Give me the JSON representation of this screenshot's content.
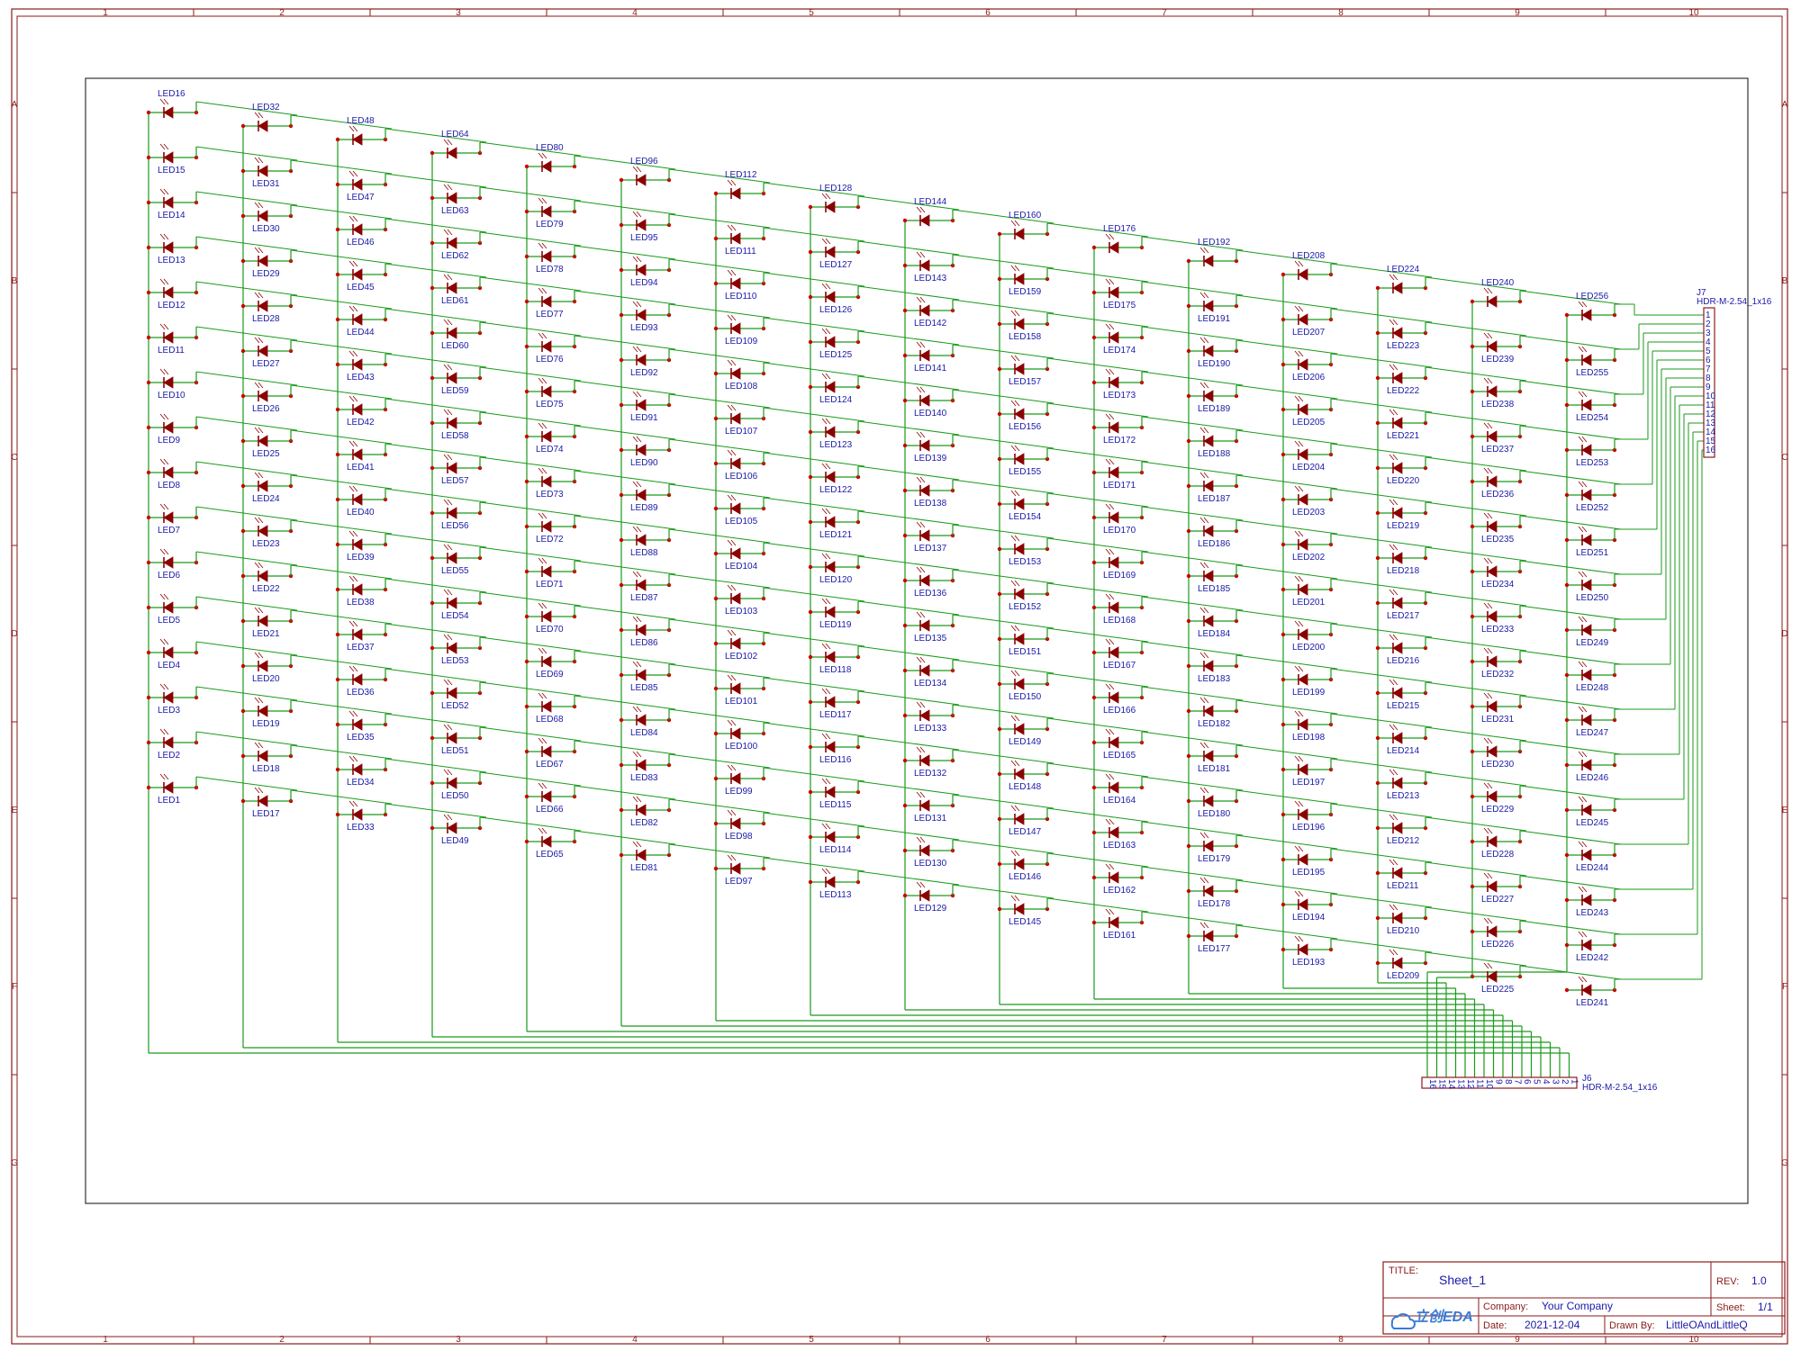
{
  "sheet": {
    "zones_x": [
      "1",
      "2",
      "3",
      "4",
      "5",
      "6",
      "7",
      "8",
      "9",
      "10"
    ],
    "zones_y": [
      "A",
      "B",
      "C",
      "D",
      "E",
      "F",
      "G"
    ]
  },
  "connectors": {
    "j7": {
      "ref": "J7",
      "footprint": "HDR-M-2.54_1x16",
      "pins": [
        "1",
        "2",
        "3",
        "4",
        "5",
        "6",
        "7",
        "8",
        "9",
        "10",
        "11",
        "12",
        "13",
        "14",
        "15",
        "16"
      ]
    },
    "j6": {
      "ref": "J6",
      "footprint": "HDR-M-2.54_1x16",
      "pins": [
        "16",
        "15",
        "14",
        "13",
        "12",
        "11",
        "10",
        "9",
        "8",
        "7",
        "6",
        "5",
        "4",
        "3",
        "2",
        "1"
      ]
    }
  },
  "led_columns": [
    [
      "LED16",
      "LED15",
      "LED14",
      "LED13",
      "LED12",
      "LED11",
      "LED10",
      "LED9",
      "LED8",
      "LED7",
      "LED6",
      "LED5",
      "LED4",
      "LED3",
      "LED2",
      "LED1"
    ],
    [
      "LED32",
      "LED31",
      "LED30",
      "LED29",
      "LED28",
      "LED27",
      "LED26",
      "LED25",
      "LED24",
      "LED23",
      "LED22",
      "LED21",
      "LED20",
      "LED19",
      "LED18",
      "LED17"
    ],
    [
      "LED48",
      "LED47",
      "LED46",
      "LED45",
      "LED44",
      "LED43",
      "LED42",
      "LED41",
      "LED40",
      "LED39",
      "LED38",
      "LED37",
      "LED36",
      "LED35",
      "LED34",
      "LED33"
    ],
    [
      "LED64",
      "LED63",
      "LED62",
      "LED61",
      "LED60",
      "LED59",
      "LED58",
      "LED57",
      "LED56",
      "LED55",
      "LED54",
      "LED53",
      "LED52",
      "LED51",
      "LED50",
      "LED49"
    ],
    [
      "LED80",
      "LED79",
      "LED78",
      "LED77",
      "LED76",
      "LED75",
      "LED74",
      "LED73",
      "LED72",
      "LED71",
      "LED70",
      "LED69",
      "LED68",
      "LED67",
      "LED66",
      "LED65"
    ],
    [
      "LED96",
      "LED95",
      "LED94",
      "LED93",
      "LED92",
      "LED91",
      "LED90",
      "LED89",
      "LED88",
      "LED87",
      "LED86",
      "LED85",
      "LED84",
      "LED83",
      "LED82",
      "LED81"
    ],
    [
      "LED112",
      "LED111",
      "LED110",
      "LED109",
      "LED108",
      "LED107",
      "LED106",
      "LED105",
      "LED104",
      "LED103",
      "LED102",
      "LED101",
      "LED100",
      "LED99",
      "LED98",
      "LED97"
    ],
    [
      "LED128",
      "LED127",
      "LED126",
      "LED125",
      "LED124",
      "LED123",
      "LED122",
      "LED121",
      "LED120",
      "LED119",
      "LED118",
      "LED117",
      "LED116",
      "LED115",
      "LED114",
      "LED113"
    ],
    [
      "LED144",
      "LED143",
      "LED142",
      "LED141",
      "LED140",
      "LED139",
      "LED138",
      "LED137",
      "LED136",
      "LED135",
      "LED134",
      "LED133",
      "LED132",
      "LED131",
      "LED130",
      "LED129"
    ],
    [
      "LED160",
      "LED159",
      "LED158",
      "LED157",
      "LED156",
      "LED155",
      "LED154",
      "LED153",
      "LED152",
      "LED151",
      "LED150",
      "LED149",
      "LED148",
      "LED147",
      "LED146",
      "LED145"
    ],
    [
      "LED176",
      "LED175",
      "LED174",
      "LED173",
      "LED172",
      "LED171",
      "LED170",
      "LED169",
      "LED168",
      "LED167",
      "LED166",
      "LED165",
      "LED164",
      "LED163",
      "LED162",
      "LED161"
    ],
    [
      "LED192",
      "LED191",
      "LED190",
      "LED189",
      "LED188",
      "LED187",
      "LED186",
      "LED185",
      "LED184",
      "LED183",
      "LED182",
      "LED181",
      "LED180",
      "LED179",
      "LED178",
      "LED177"
    ],
    [
      "LED208",
      "LED207",
      "LED206",
      "LED205",
      "LED204",
      "LED203",
      "LED202",
      "LED201",
      "LED200",
      "LED199",
      "LED198",
      "LED197",
      "LED196",
      "LED195",
      "LED194",
      "LED193"
    ],
    [
      "LED224",
      "LED223",
      "LED222",
      "LED221",
      "LED220",
      "LED219",
      "LED218",
      "LED217",
      "LED216",
      "LED215",
      "LED214",
      "LED213",
      "LED212",
      "LED211",
      "LED210",
      "LED209"
    ],
    [
      "LED240",
      "LED239",
      "LED238",
      "LED237",
      "LED236",
      "LED235",
      "LED234",
      "LED233",
      "LED232",
      "LED231",
      "LED230",
      "LED229",
      "LED228",
      "LED227",
      "LED226",
      "LED225"
    ],
    [
      "LED256",
      "LED255",
      "LED254",
      "LED253",
      "LED252",
      "LED251",
      "LED250",
      "LED249",
      "LED248",
      "LED247",
      "LED246",
      "LED245",
      "LED244",
      "LED243",
      "LED242",
      "LED241"
    ]
  ],
  "title_block": {
    "title_label": "TITLE:",
    "title": "Sheet_1",
    "rev_label": "REV:",
    "rev": "1.0",
    "company_label": "Company:",
    "company": "Your Company",
    "sheet_label": "Sheet:",
    "sheet": "1/1",
    "date_label": "Date:",
    "date": "2021-12-04",
    "drawn_label": "Drawn By:",
    "drawn_by": "LittleOAndLittleQ",
    "logo": "立创EDA"
  },
  "colors": {
    "frame": "#8b1a1a",
    "wire": "#1a9a1a",
    "led": "#8b0000",
    "junction": "#cc0000",
    "label": "#1a1aa8"
  }
}
